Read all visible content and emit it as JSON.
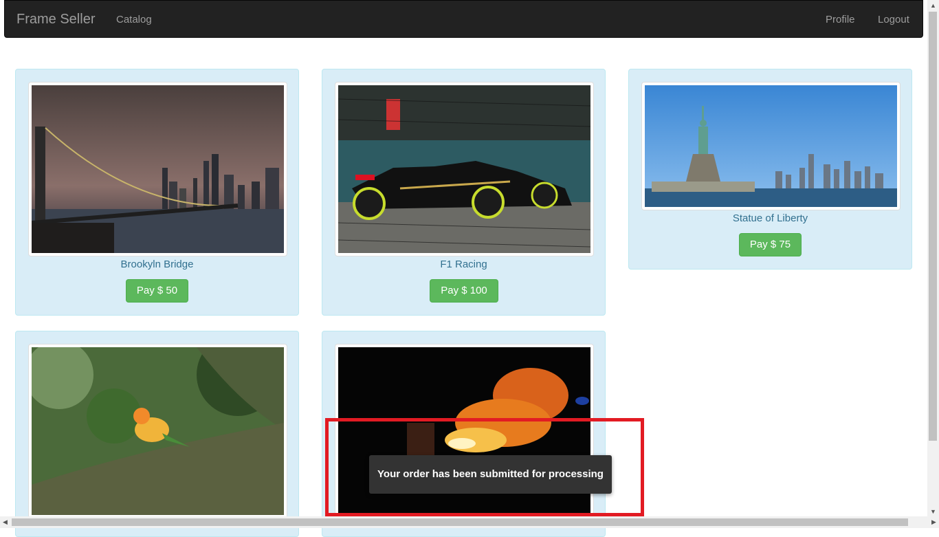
{
  "navbar": {
    "brand": "Frame Seller",
    "catalog": "Catalog",
    "profile": "Profile",
    "logout": "Logout"
  },
  "products": [
    {
      "title": "Brookyln Bridge",
      "pay_label": "Pay $ 50"
    },
    {
      "title": "F1 Racing",
      "pay_label": "Pay $ 100"
    },
    {
      "title": "Statue of Liberty",
      "pay_label": "Pay $ 75"
    },
    {
      "title": "",
      "pay_label": ""
    },
    {
      "title": "",
      "pay_label": ""
    }
  ],
  "toast": {
    "message": "Your order has been submitted for processing"
  },
  "colors": {
    "navbar_bg": "#222222",
    "card_bg": "#d9edf7",
    "caption": "#31708f",
    "pay_button": "#5cb85c",
    "highlight": "#e21b23"
  }
}
